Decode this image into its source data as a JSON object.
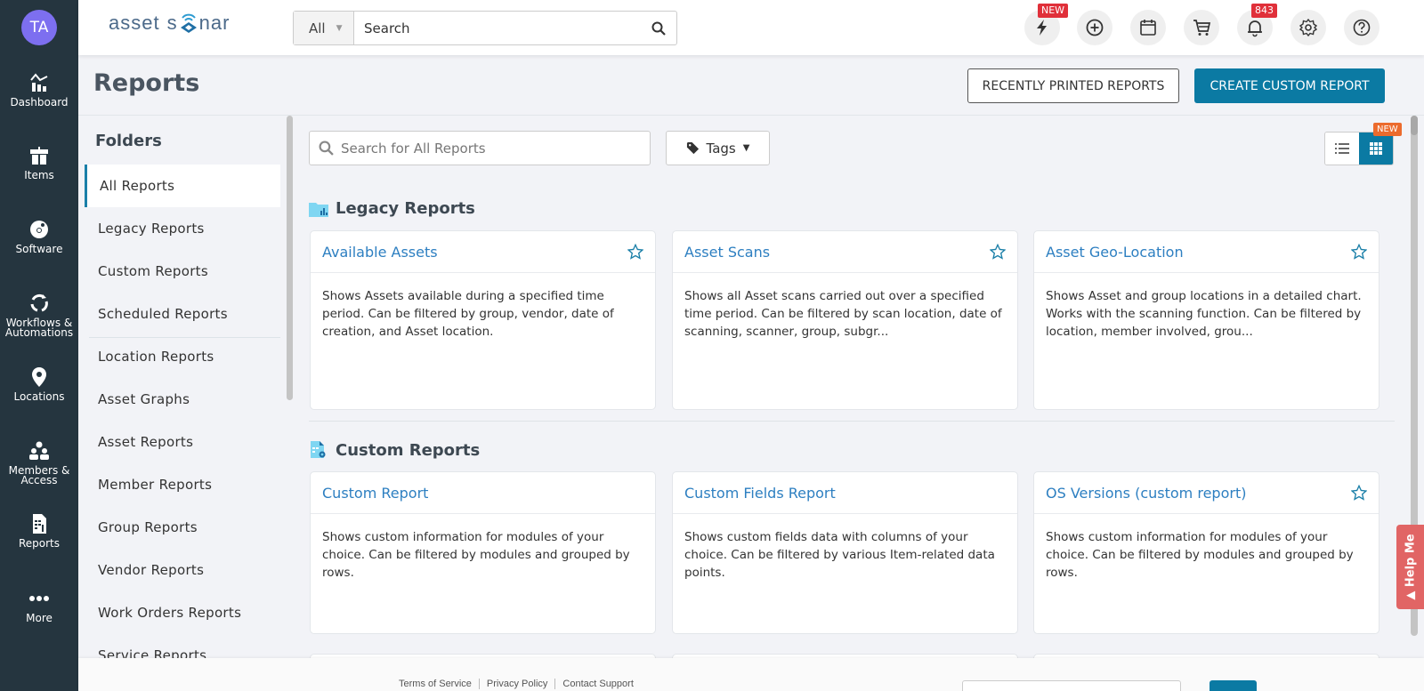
{
  "user": {
    "initials": "TA"
  },
  "nav": [
    {
      "label": "Dashboard",
      "icon": "dashboard-icon"
    },
    {
      "label": "Items",
      "icon": "items-icon"
    },
    {
      "label": "Software",
      "icon": "software-icon"
    },
    {
      "label": "Workflows & Automations",
      "icon": "workflows-icon"
    },
    {
      "label": "Locations",
      "icon": "location-pin-icon"
    },
    {
      "label": "Members & Access",
      "icon": "members-icon"
    },
    {
      "label": "Reports",
      "icon": "reports-icon"
    },
    {
      "label": "More",
      "icon": "more-icon"
    }
  ],
  "brand": {
    "name_left": "asset",
    "name_s": "s",
    "name_right": "nar"
  },
  "search": {
    "scope": "All",
    "placeholder": "Search"
  },
  "topicons": {
    "quick_badge": "NEW",
    "notifications_count": "843"
  },
  "page": {
    "title": "Reports",
    "recently_printed_label": "RECENTLY PRINTED REPORTS",
    "create_custom_label": "CREATE CUSTOM REPORT"
  },
  "folders": {
    "title": "Folders",
    "items": [
      "All Reports",
      "Legacy Reports",
      "Custom Reports",
      "Scheduled Reports",
      "Location Reports",
      "Asset Graphs",
      "Asset Reports",
      "Member Reports",
      "Group Reports",
      "Vendor Reports",
      "Work Orders Reports",
      "Service Reports"
    ],
    "active_index": 0
  },
  "filters": {
    "search_placeholder": "Search for All Reports",
    "tags_label": "Tags",
    "view_new_badge": "NEW",
    "active_view": "grid"
  },
  "sections": [
    {
      "title": "Legacy Reports",
      "cards": [
        {
          "title": "Available Assets",
          "desc": "Shows Assets available during a specified time period. Can be filtered by group, vendor, date of creation, and Asset location.",
          "star": true
        },
        {
          "title": "Asset Scans",
          "desc": "Shows all Asset scans carried out over a specified time period. Can be filtered by scan location, date of scanning, scanner, group, subgr...",
          "star": true
        },
        {
          "title": "Asset Geo-Location",
          "desc": "Shows Asset and group locations in a detailed chart. Works with the scanning function. Can be filtered by location, member involved, grou...",
          "star": true
        }
      ]
    },
    {
      "title": "Custom Reports",
      "cards": [
        {
          "title": "Custom Report",
          "desc": "Shows custom information for modules of your choice. Can be filtered by modules and grouped by rows.",
          "star": false
        },
        {
          "title": "Custom Fields Report",
          "desc": "Shows custom fields data with columns of your choice. Can be filtered by various Item-related data points.",
          "star": false
        },
        {
          "title": "OS Versions (custom report)",
          "desc": "Shows custom information for modules of your choice. Can be filtered by modules and grouped by rows.",
          "star": true
        }
      ]
    }
  ],
  "help": {
    "label": "▲ Help Me"
  },
  "footer": {
    "links": [
      "Terms of Service",
      "Privacy Policy",
      "Contact Support"
    ]
  },
  "colors": {
    "primary": "#0b7aa3",
    "sidebar": "#25353f",
    "link": "#2d7fc1",
    "badge_red": "#e0303a",
    "badge_orange": "#ec6b2d",
    "help": "#e16565"
  }
}
